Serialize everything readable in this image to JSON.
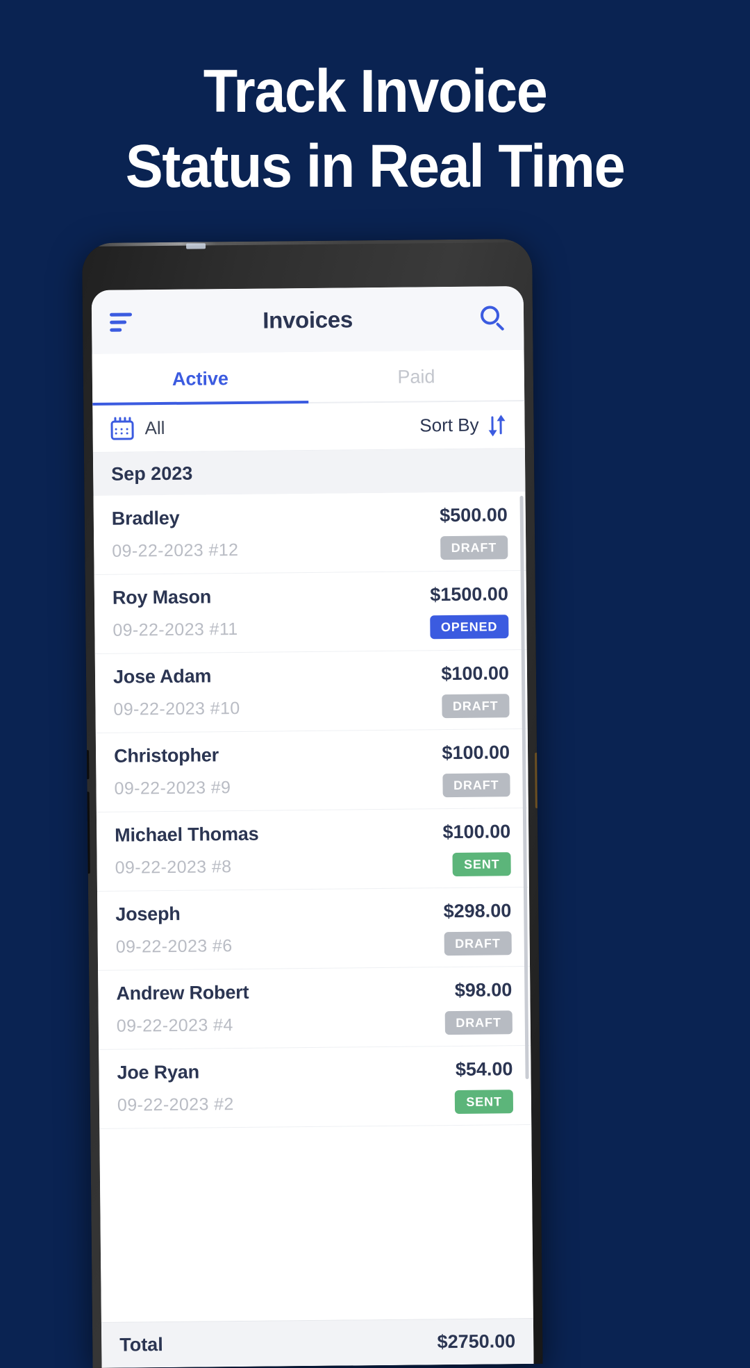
{
  "promo": {
    "headline_line1": "Track Invoice",
    "headline_line2": "Status in Real Time",
    "background_color": "#0a2352",
    "headline_color": "#ffffff"
  },
  "app": {
    "header": {
      "title": "Invoices",
      "menu_icon": "hamburger-menu-icon",
      "search_icon": "search-icon",
      "background_color": "#f6f7fa",
      "accent_color": "#3b5be0"
    },
    "tabs": [
      {
        "label": "Active",
        "selected": true
      },
      {
        "label": "Paid",
        "selected": false
      }
    ],
    "filter_bar": {
      "calendar_icon": "calendar-icon",
      "filter_label": "All",
      "sort_label": "Sort By",
      "sort_icon": "sort-arrows-icon"
    },
    "section_header": "Sep 2023",
    "invoices": [
      {
        "name": "Bradley",
        "date": "09-22-2023 #12",
        "amount": "$500.00",
        "status": "DRAFT",
        "status_color": "#b7bbc2"
      },
      {
        "name": "Roy Mason",
        "date": "09-22-2023 #11",
        "amount": "$1500.00",
        "status": "OPENED",
        "status_color": "#3b5be0"
      },
      {
        "name": "Jose Adam",
        "date": "09-22-2023 #10",
        "amount": "$100.00",
        "status": "DRAFT",
        "status_color": "#b7bbc2"
      },
      {
        "name": "Christopher",
        "date": "09-22-2023 #9",
        "amount": "$100.00",
        "status": "DRAFT",
        "status_color": "#b7bbc2"
      },
      {
        "name": "Michael Thomas",
        "date": "09-22-2023 #8",
        "amount": "$100.00",
        "status": "SENT",
        "status_color": "#5cb57a"
      },
      {
        "name": "Joseph",
        "date": "09-22-2023 #6",
        "amount": "$298.00",
        "status": "DRAFT",
        "status_color": "#b7bbc2"
      },
      {
        "name": "Andrew Robert",
        "date": "09-22-2023 #4",
        "amount": "$98.00",
        "status": "DRAFT",
        "status_color": "#b7bbc2"
      },
      {
        "name": "Joe Ryan",
        "date": "09-22-2023 #2",
        "amount": "$54.00",
        "status": "SENT",
        "status_color": "#5cb57a"
      }
    ],
    "total": {
      "label": "Total",
      "amount": "$2750.00"
    }
  }
}
